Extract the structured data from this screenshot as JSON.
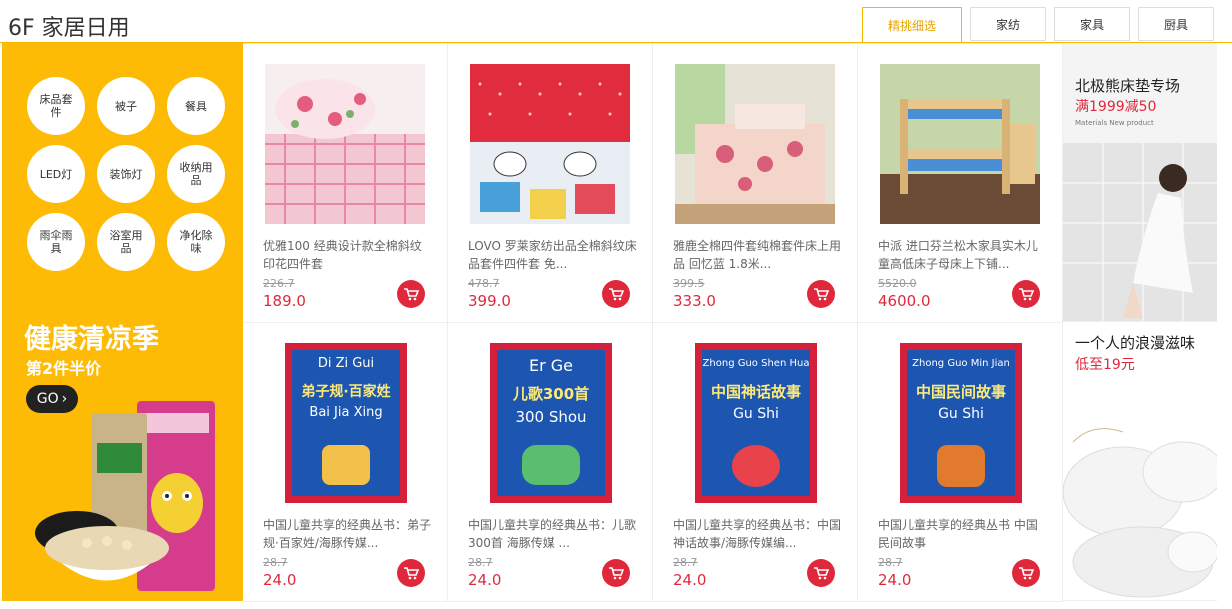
{
  "floor": {
    "title": "6F 家居日用"
  },
  "tabs": [
    "精挑细选",
    "家纺",
    "家具",
    "厨具"
  ],
  "categories": [
    "床品套件",
    "被子",
    "餐具",
    "LED灯",
    "装饰灯",
    "收纳用品",
    "雨伞雨具",
    "浴室用品",
    "净化除味"
  ],
  "promo": {
    "title": "健康清凉季",
    "subtitle": "第2件半价",
    "go": "GO"
  },
  "products": [
    {
      "desc": "优雅100 经典设计款全棉斜纹印花四件套",
      "old": "226.7",
      "price": "189.0"
    },
    {
      "desc": "LOVO 罗莱家纺出品全棉斜纹床品套件四件套 免...",
      "old": "478.7",
      "price": "399.0"
    },
    {
      "desc": "雅鹿全棉四件套纯棉套件床上用品 回忆蓝 1.8米...",
      "old": "399.5",
      "price": "333.0"
    },
    {
      "desc": "中派 进口芬兰松木家具实木儿童高低床子母床上下铺...",
      "old": "5520.0",
      "price": "4600.0"
    },
    {
      "desc": "中国儿童共享的经典丛书：弟子规·百家姓/海豚传媒...",
      "old": "28.7",
      "price": "24.0"
    },
    {
      "desc": "中国儿童共享的经典丛书：儿歌300首 海豚传媒 ...",
      "old": "28.7",
      "price": "24.0"
    },
    {
      "desc": "中国儿童共享的经典丛书：中国神话故事/海豚传媒编...",
      "old": "28.7",
      "price": "24.0"
    },
    {
      "desc": "中国儿童共享的经典丛书 中国民间故事",
      "old": "28.7",
      "price": "24.0"
    }
  ],
  "books": [
    {
      "pinyin1": "Di Zi Gui",
      "title": "弟子规·百家姓",
      "pinyin2": "Bai Jia Xing"
    },
    {
      "pinyin1": "Er Ge",
      "title": "儿歌300首",
      "pinyin2": "300 Shou"
    },
    {
      "pinyin1": "Zhong Guo Shen Hua",
      "title": "中国神话故事",
      "pinyin2": "Gu Shi"
    },
    {
      "pinyin1": "Zhong Guo Min Jian",
      "title": "中国民间故事",
      "pinyin2": "Gu Shi"
    }
  ],
  "ads": [
    {
      "title": "北极熊床垫专场",
      "sub": "满1999减50",
      "note": "Materials New product"
    },
    {
      "title": "一个人的浪漫滋味",
      "sub": "低至19元",
      "note": ""
    }
  ],
  "colors": {
    "accent": "#fdbb06",
    "price": "#e0283c",
    "book_border": "#d4203a",
    "book_bg": "#1c56b0"
  }
}
